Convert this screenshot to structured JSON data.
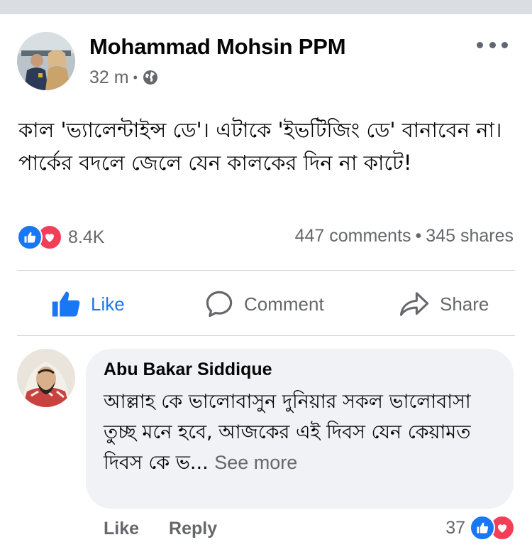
{
  "post": {
    "author": "Mohammad Mohsin PPM",
    "time": "32 m",
    "separator": "•",
    "privacy_icon": "globe-icon",
    "text": "কাল 'ভ্যালেন্টাইন্স ডে'। এটাকে 'ইভটিজিং ডে' বানাবেন না। পার্কের বদলে জেলে যেন কালকের দিন না কাটে!",
    "reactions_count": "8.4K",
    "reaction_icons": [
      "like-reaction-icon",
      "love-reaction-icon"
    ],
    "comments_count": "447 comments",
    "stats_separator": "•",
    "shares_count": "345 shares"
  },
  "actions": {
    "like_label": "Like",
    "comment_label": "Comment",
    "share_label": "Share"
  },
  "comment": {
    "author": "Abu Bakar Siddique",
    "text": "আল্লাহ কে ভালোবাসুন দুনিয়ার সকল ভালোবাসা তুচ্ছ মনে হবে, আজকের এই দিবস যেন কেয়ামত দিবস কে ভ...",
    "see_more": "See more",
    "like_label": "Like",
    "reply_label": "Reply",
    "reactions_count": "37"
  },
  "colors": {
    "brand_blue": "#1877f2",
    "love_red": "#f33e58",
    "secondary_text": "#65676b",
    "bubble_bg": "#f0f2f5"
  }
}
